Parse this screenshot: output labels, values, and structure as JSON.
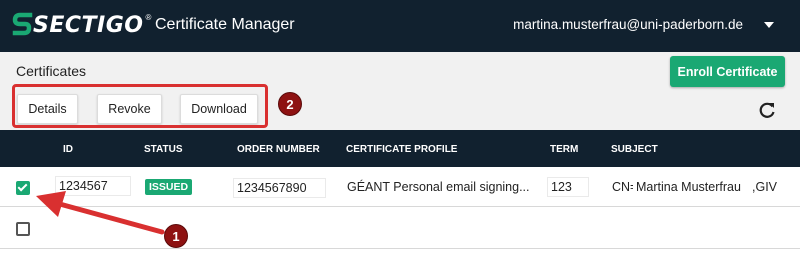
{
  "header": {
    "logo_text": "SECTIGO",
    "logo_reg": "®",
    "app_title": "Certificate Manager",
    "user_email": "martina.musterfrau@uni-paderborn.de",
    "background": "#11212f"
  },
  "toolbar": {
    "section_title": "Certificates",
    "enroll_label": "Enroll Certificate",
    "details_label": "Details",
    "revoke_label": "Revoke",
    "download_label": "Download",
    "refresh_icon": "refresh-icon",
    "accent": "#1aa873"
  },
  "table": {
    "columns": [
      "ID",
      "STATUS",
      "ORDER NUMBER",
      "CERTIFICATE PROFILE",
      "TERM",
      "SUBJECT"
    ],
    "rows": [
      {
        "selected": true,
        "id": "1234567",
        "status": "ISSUED",
        "order_number": "1234567890",
        "profile": "GÉANT Personal email signing...",
        "term": "123",
        "subject_prefix": "CN=",
        "subject_name": "Martina Musterfrau",
        "subject_suffix": ",GIV"
      },
      {
        "selected": false
      }
    ]
  },
  "annotations": {
    "marker_1": "1",
    "marker_2": "2",
    "color": "#d93030"
  }
}
